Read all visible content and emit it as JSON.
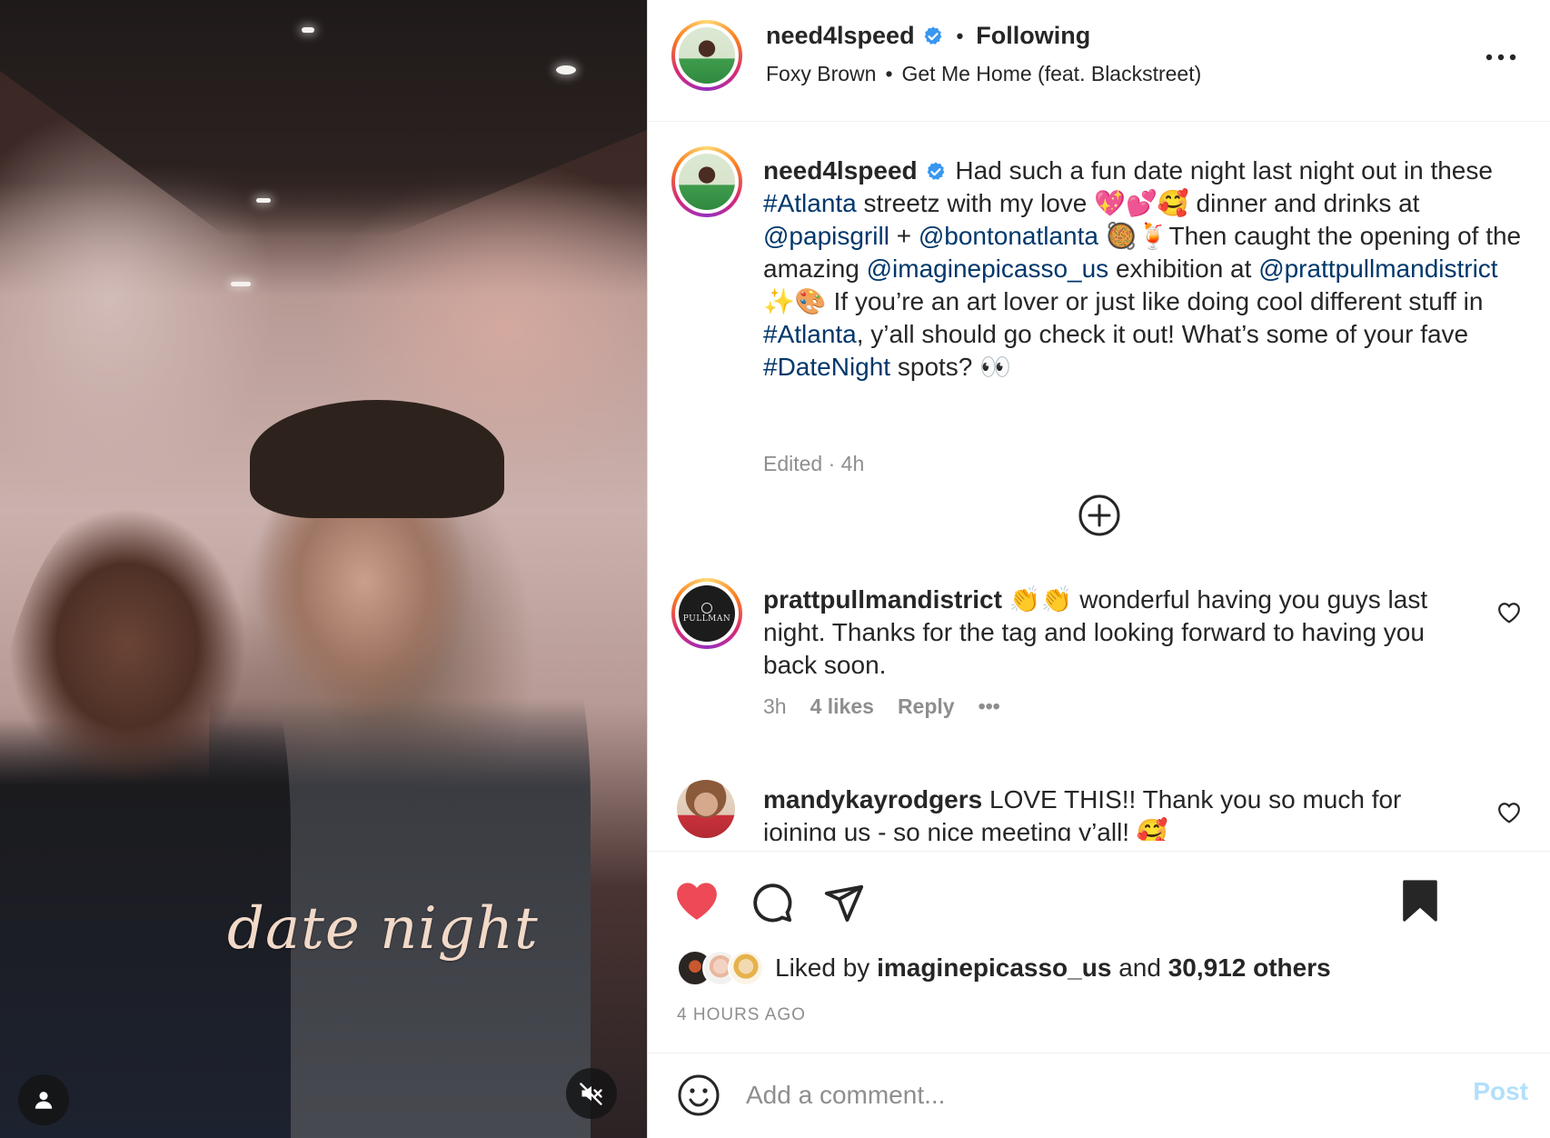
{
  "media": {
    "overlay_caption": "date night"
  },
  "header": {
    "username": "need4lspeed",
    "separator": "•",
    "following_label": "Following",
    "audio_artist": "Foxy Brown",
    "audio_separator": "•",
    "audio_track": "Get Me Home (feat. Blackstreet)"
  },
  "caption": {
    "username": "need4lspeed",
    "parts": [
      " Had such a fun date night last night out in these ",
      "#Atlanta",
      " streetz with my love 💖💕🥰 dinner and drinks at ",
      "@papisgrill",
      " + ",
      "@bontonatlanta",
      " 🥘🍹Then caught the opening of the amazing ",
      "@imaginepicasso_us",
      " exhibition at ",
      "@prattpullmandistrict",
      " ✨🎨 If you’re an art lover or just like doing cool different stuff in ",
      "#Atlanta",
      ", y’all should go check it out! What’s some of your fave ",
      "#DateNight",
      " spots? 👀"
    ],
    "meta": "Edited · 4h"
  },
  "comments": [
    {
      "username": "prattpullmandistrict",
      "avatar_text": "PULLMAN",
      "text": " 👏👏 wonderful having you guys last night. Thanks for the tag and looking forward to having you back soon.",
      "time": "3h",
      "likes": "4 likes",
      "reply": "Reply",
      "more": "•••"
    },
    {
      "username": "mandykayrodgers",
      "text": " LOVE THIS!! Thank you so much for joining us - so nice meeting y’all! 🥰"
    }
  ],
  "actions": {
    "liked_by_prefix": "Liked by ",
    "liked_by_user": "imaginepicasso_us",
    "liked_by_and": " and ",
    "liked_by_count": "30,912 others",
    "time_ago": "4 HOURS AGO"
  },
  "add_comment": {
    "placeholder": "Add a comment...",
    "post_label": "Post"
  },
  "colors": {
    "like_red": "#ed4956",
    "link_blue": "#00376b",
    "verified_blue": "#3897f0",
    "post_disabled": "#b2dffc",
    "muted_text": "#8e8e8e"
  }
}
